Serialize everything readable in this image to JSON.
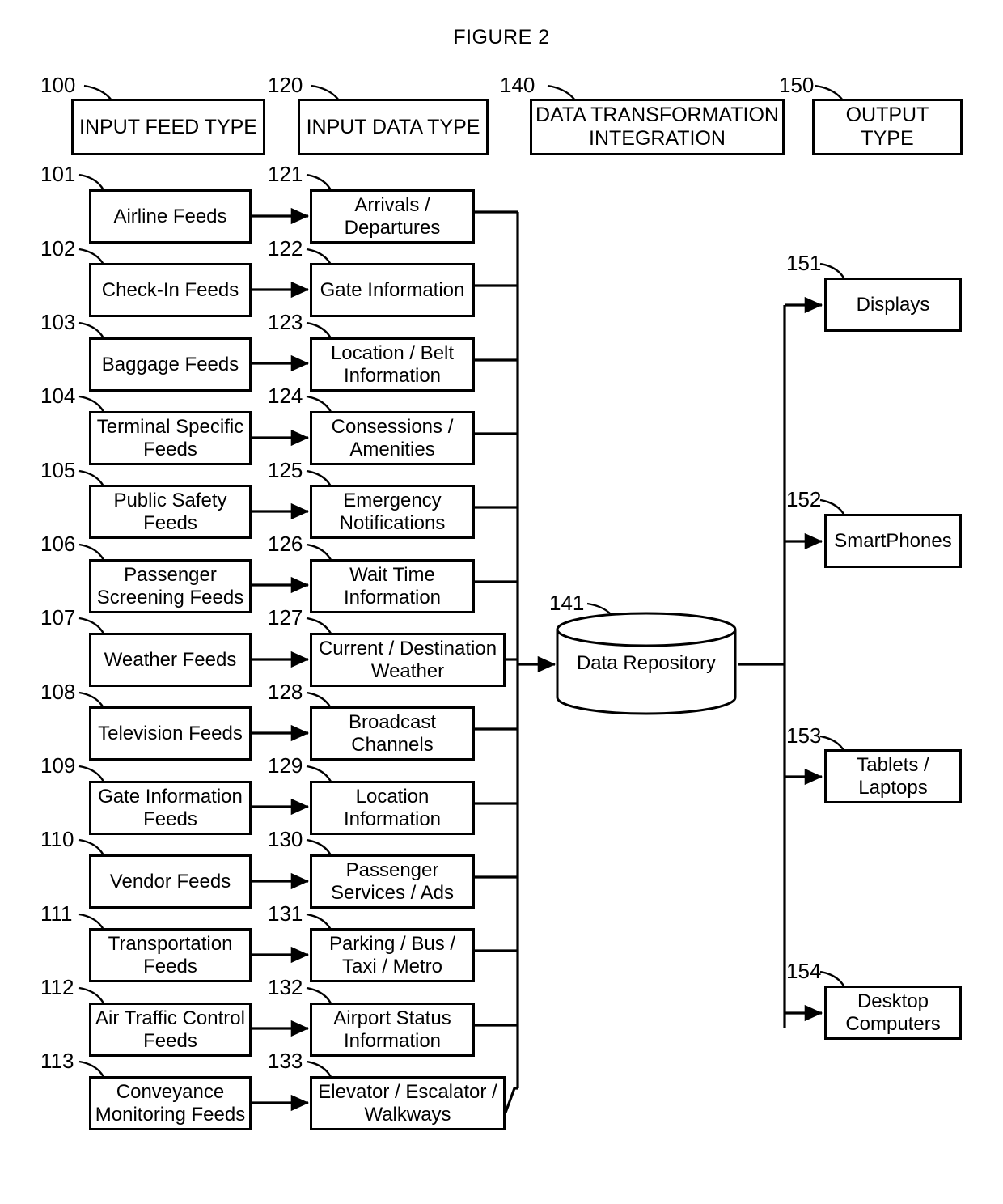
{
  "figure": {
    "title": "FIGURE 2"
  },
  "headers": [
    {
      "ref": "100",
      "label": "INPUT FEED TYPE"
    },
    {
      "ref": "120",
      "label": "INPUT DATA TYPE"
    },
    {
      "ref": "140",
      "label": "DATA TRANSFORMATION INTEGRATION"
    },
    {
      "ref": "150",
      "label": "OUTPUT TYPE"
    }
  ],
  "input_feeds": [
    {
      "ref": "101",
      "label": "Airline Feeds"
    },
    {
      "ref": "102",
      "label": "Check-In Feeds"
    },
    {
      "ref": "103",
      "label": "Baggage Feeds"
    },
    {
      "ref": "104",
      "label": "Terminal Specific Feeds"
    },
    {
      "ref": "105",
      "label": "Public Safety Feeds"
    },
    {
      "ref": "106",
      "label": "Passenger Screening Feeds"
    },
    {
      "ref": "107",
      "label": "Weather Feeds"
    },
    {
      "ref": "108",
      "label": "Television Feeds"
    },
    {
      "ref": "109",
      "label": "Gate Information Feeds"
    },
    {
      "ref": "110",
      "label": "Vendor Feeds"
    },
    {
      "ref": "111",
      "label": "Transportation Feeds"
    },
    {
      "ref": "112",
      "label": "Air Traffic Control Feeds"
    },
    {
      "ref": "113",
      "label": "Conveyance Monitoring Feeds"
    }
  ],
  "input_data_types": [
    {
      "ref": "121",
      "label": "Arrivals / Departures"
    },
    {
      "ref": "122",
      "label": "Gate Information"
    },
    {
      "ref": "123",
      "label": "Location / Belt Information"
    },
    {
      "ref": "124",
      "label": "Consessions / Amenities"
    },
    {
      "ref": "125",
      "label": "Emergency Notifications"
    },
    {
      "ref": "126",
      "label": "Wait Time Information"
    },
    {
      "ref": "127",
      "label": "Current / Destination Weather"
    },
    {
      "ref": "128",
      "label": "Broadcast Channels"
    },
    {
      "ref": "129",
      "label": "Location Information"
    },
    {
      "ref": "130",
      "label": "Passenger Services / Ads"
    },
    {
      "ref": "131",
      "label": "Parking / Bus / Taxi / Metro"
    },
    {
      "ref": "132",
      "label": "Airport Status Information"
    },
    {
      "ref": "133",
      "label": "Elevator / Escalator / Walkways"
    }
  ],
  "repository": {
    "ref": "141",
    "label": "Data Repository"
  },
  "outputs": [
    {
      "ref": "151",
      "label": "Displays"
    },
    {
      "ref": "152",
      "label": "SmartPhones"
    },
    {
      "ref": "153",
      "label": "Tablets / Laptops"
    },
    {
      "ref": "154",
      "label": "Desktop Computers"
    }
  ]
}
